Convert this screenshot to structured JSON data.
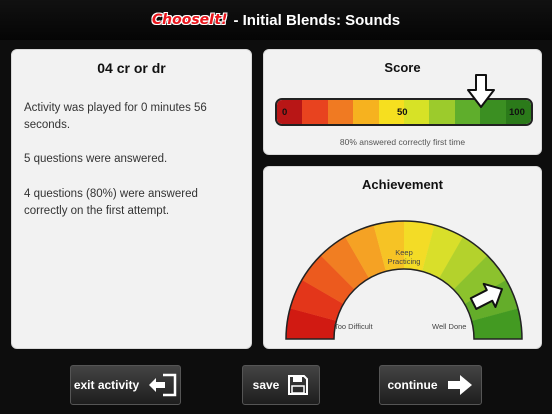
{
  "header": {
    "brand": "ChooseIt!",
    "title": "- Initial Blends: Sounds"
  },
  "summary": {
    "title": "04  cr or dr",
    "line1": "Activity was played for 0 minutes 56 seconds.",
    "line2": "5 questions were answered.",
    "line3": "4 questions (80%) were answered correctly on the first attempt."
  },
  "score": {
    "title": "Score",
    "min_label": "0",
    "mid_label": "50",
    "max_label": "100",
    "percent": 80,
    "caption": "80% answered correctly first time"
  },
  "achievement": {
    "title": "Achievement",
    "left_label": "Too Difficult",
    "middle_label": "Keep Practicing",
    "right_label": "Well Done",
    "level": 0.85
  },
  "footer": {
    "exit_label": "exit activity",
    "save_label": "save",
    "continue_label": "continue"
  },
  "colors": {
    "bar_segments": [
      "#b81616",
      "#e8431f",
      "#f07a22",
      "#f6b21f",
      "#f6df1f",
      "#d7e226",
      "#9ccb2c",
      "#5fae2c",
      "#3b8f22",
      "#2b7a1a"
    ]
  }
}
